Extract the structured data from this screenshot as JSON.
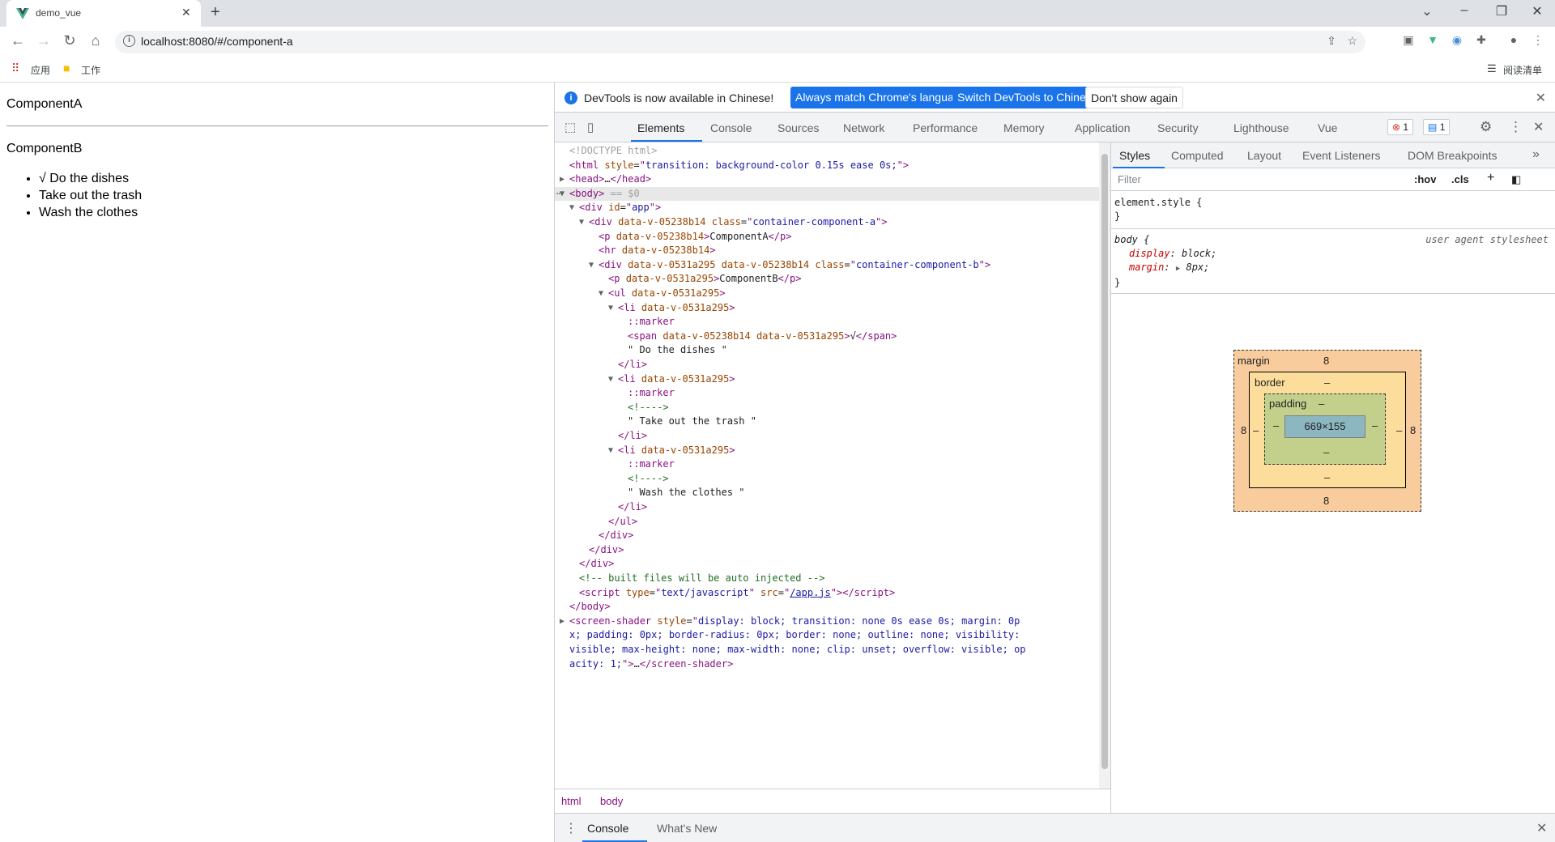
{
  "browser": {
    "tab_title": "demo_vue",
    "tab_close": "✕",
    "new_tab": "+",
    "url": "localhost:8080/#/component-a",
    "bookmarks": [
      {
        "label": "应用"
      },
      {
        "label": "工作"
      }
    ],
    "reading_list": "阅读清单",
    "window_controls": {
      "minimize": "–",
      "restore": "❐",
      "close": "✕",
      "tab_search": "⌄"
    }
  },
  "page": {
    "component_a": "ComponentA",
    "component_b": "ComponentB",
    "items": [
      "√ Do the dishes",
      "Take out the trash",
      "Wash the clothes"
    ]
  },
  "devtools": {
    "infobar": {
      "message": "DevTools is now available in Chinese!",
      "btn_match": "Always match Chrome's language",
      "btn_switch": "Switch DevTools to Chinese",
      "btn_dont": "Don't show again"
    },
    "tabs": [
      "Elements",
      "Console",
      "Sources",
      "Network",
      "Performance",
      "Memory",
      "Application",
      "Security",
      "Lighthouse",
      "Vue"
    ],
    "active_tab": "Elements",
    "error_count": "1",
    "message_count": "1",
    "dom_lines": [
      {
        "indent": 0,
        "tri": "",
        "html": "<span class='gray'>&lt;!DOCTYPE html&gt;</span>"
      },
      {
        "indent": 0,
        "tri": "",
        "html": "<span class='tag'>&lt;html</span> <span class='attr'>style</span>=<span class='tag'>\"</span><span class='val'>transition: background-color 0.15s ease 0s;</span><span class='tag'>\"&gt;</span>"
      },
      {
        "indent": 0,
        "tri": "▶",
        "html": "<span class='tag'>&lt;head&gt;</span>…<span class='tag'>&lt;/head&gt;</span>"
      },
      {
        "indent": 0,
        "tri": "▼",
        "sel": true,
        "html": "<span class='tag'>&lt;body&gt;</span> <span class='gray'>== $0</span>"
      },
      {
        "indent": 1,
        "tri": "▼",
        "html": "<span class='tag'>&lt;div</span> <span class='attr'>id</span>=<span class='tag'>\"</span><span class='val'>app</span><span class='tag'>\"&gt;</span>"
      },
      {
        "indent": 2,
        "tri": "▼",
        "html": "<span class='tag'>&lt;div</span> <span class='attr'>data-v-05238b14</span> <span class='attr'>class</span>=<span class='tag'>\"</span><span class='val'>container-component-a</span><span class='tag'>\"&gt;</span>"
      },
      {
        "indent": 3,
        "tri": "",
        "html": "<span class='tag'>&lt;p</span> <span class='attr'>data-v-05238b14</span><span class='tag'>&gt;</span><span class='txt'>ComponentA</span><span class='tag'>&lt;/p&gt;</span>"
      },
      {
        "indent": 3,
        "tri": "",
        "html": "<span class='tag'>&lt;hr</span> <span class='attr'>data-v-05238b14</span><span class='tag'>&gt;</span>"
      },
      {
        "indent": 3,
        "tri": "▼",
        "html": "<span class='tag'>&lt;div</span> <span class='attr'>data-v-0531a295 data-v-05238b14</span> <span class='attr'>class</span>=<span class='tag'>\"</span><span class='val'>container-component-b</span><span class='tag'>\"&gt;</span>"
      },
      {
        "indent": 4,
        "tri": "",
        "html": "<span class='tag'>&lt;p</span> <span class='attr'>data-v-0531a295</span><span class='tag'>&gt;</span><span class='txt'>ComponentB</span><span class='tag'>&lt;/p&gt;</span>"
      },
      {
        "indent": 4,
        "tri": "▼",
        "html": "<span class='tag'>&lt;ul</span> <span class='attr'>data-v-0531a295</span><span class='tag'>&gt;</span>"
      },
      {
        "indent": 5,
        "tri": "▼",
        "html": "<span class='tag'>&lt;li</span> <span class='attr'>data-v-0531a295</span><span class='tag'>&gt;</span>"
      },
      {
        "indent": 6,
        "tri": "",
        "html": "<span class='pseudo'>::marker</span>"
      },
      {
        "indent": 6,
        "tri": "",
        "html": "<span class='tag'>&lt;span</span> <span class='attr'>data-v-05238b14 data-v-0531a295</span><span class='tag'>&gt;</span><span class='txt'>√</span><span class='tag'>&lt;/span&gt;</span>"
      },
      {
        "indent": 6,
        "tri": "",
        "html": "<span class='txt'>\" Do the dishes \"</span>"
      },
      {
        "indent": 5,
        "tri": "",
        "html": "<span class='tag'>&lt;/li&gt;</span>"
      },
      {
        "indent": 5,
        "tri": "▼",
        "html": "<span class='tag'>&lt;li</span> <span class='attr'>data-v-0531a295</span><span class='tag'>&gt;</span>"
      },
      {
        "indent": 6,
        "tri": "",
        "html": "<span class='pseudo'>::marker</span>"
      },
      {
        "indent": 6,
        "tri": "",
        "html": "<span class='cmt'>&lt;!----&gt;</span>"
      },
      {
        "indent": 6,
        "tri": "",
        "html": "<span class='txt'>\" Take out the trash \"</span>"
      },
      {
        "indent": 5,
        "tri": "",
        "html": "<span class='tag'>&lt;/li&gt;</span>"
      },
      {
        "indent": 5,
        "tri": "▼",
        "html": "<span class='tag'>&lt;li</span> <span class='attr'>data-v-0531a295</span><span class='tag'>&gt;</span>"
      },
      {
        "indent": 6,
        "tri": "",
        "html": "<span class='pseudo'>::marker</span>"
      },
      {
        "indent": 6,
        "tri": "",
        "html": "<span class='cmt'>&lt;!----&gt;</span>"
      },
      {
        "indent": 6,
        "tri": "",
        "html": "<span class='txt'>\" Wash the clothes \"</span>"
      },
      {
        "indent": 5,
        "tri": "",
        "html": "<span class='tag'>&lt;/li&gt;</span>"
      },
      {
        "indent": 4,
        "tri": "",
        "html": "<span class='tag'>&lt;/ul&gt;</span>"
      },
      {
        "indent": 3,
        "tri": "",
        "html": "<span class='tag'>&lt;/div&gt;</span>"
      },
      {
        "indent": 2,
        "tri": "",
        "html": "<span class='tag'>&lt;/div&gt;</span>"
      },
      {
        "indent": 1,
        "tri": "",
        "html": "<span class='tag'>&lt;/div&gt;</span>"
      },
      {
        "indent": 1,
        "tri": "",
        "html": "<span class='cmt'>&lt;!-- built files will be auto injected --&gt;</span>"
      },
      {
        "indent": 1,
        "tri": "",
        "html": "<span class='tag'>&lt;script</span> <span class='attr'>type</span>=<span class='tag'>\"</span><span class='val'>text/javascript</span><span class='tag'>\"</span> <span class='attr'>src</span>=<span class='tag'>\"</span><span class='link'>/app.js</span><span class='tag'>\"&gt;&lt;/script&gt;</span>"
      },
      {
        "indent": 0,
        "tri": "",
        "html": "<span class='tag'>&lt;/body&gt;</span>"
      },
      {
        "indent": 0,
        "tri": "▶",
        "html": "<span class='tag'>&lt;screen-shader</span> <span class='attr'>style</span>=<span class='tag'>\"</span><span class='val'>display: block; transition: none 0s ease 0s; margin: 0p</span>"
      },
      {
        "indent": 0,
        "tri": "",
        "html": "<span class='val'>x; padding: 0px; border-radius: 0px; border: none; outline: none; visibility:</span>"
      },
      {
        "indent": 0,
        "tri": "",
        "html": "<span class='val'>visible; max-height: none; max-width: none; clip: unset; overflow: visible; op</span>"
      },
      {
        "indent": 0,
        "tri": "",
        "html": "<span class='val'>acity: 1;</span><span class='tag'>\"&gt;</span>…<span class='tag'>&lt;/screen-shader&gt;</span>"
      }
    ],
    "breadcrumbs": [
      "html",
      "body"
    ],
    "styles_tabs": [
      "Styles",
      "Computed",
      "Layout",
      "Event Listeners",
      "DOM Breakpoints"
    ],
    "filter_placeholder": "Filter",
    "filter_hov": ":hov",
    "filter_cls": ".cls",
    "element_style": "element.style {",
    "closing_brace": "}",
    "body_selector": "body {",
    "user_agent": "user agent stylesheet",
    "prop_display": "display",
    "val_display": "block",
    "prop_margin": "margin",
    "val_margin": "8px",
    "boxmodel": {
      "margin_label": "margin",
      "border_label": "border",
      "padding_label": "padding",
      "content": "669×155",
      "margin_top": "8",
      "margin_bottom": "8",
      "margin_left": "8",
      "margin_right": "8",
      "dash": "–"
    },
    "drawer_tabs": [
      "Console",
      "What's New"
    ]
  }
}
